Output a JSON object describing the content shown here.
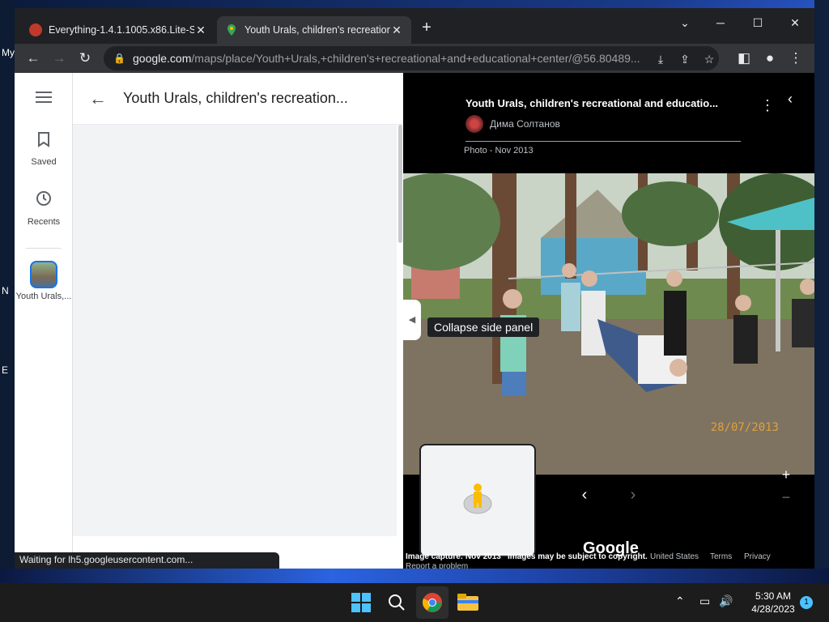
{
  "desktop": {
    "icon_labels": [
      "My",
      "N",
      "E"
    ]
  },
  "browser": {
    "tabs": [
      {
        "title": "Everything-1.4.1.1005.x86.Lite-Se",
        "active": false,
        "favicon": "everything-favicon-icon"
      },
      {
        "title": "Youth Urals, children's recreation",
        "active": true,
        "favicon": "maps-pin-icon"
      }
    ],
    "address": {
      "host": "google.com",
      "path": "/maps/place/Youth+Urals,+children's+recreational+and+educational+center/@56.80489..."
    }
  },
  "maps": {
    "rail": {
      "saved_label": "Saved",
      "recents_label": "Recents",
      "recent_place_label": "Youth Urals,..."
    },
    "side_panel": {
      "title": "Youth Urals, children's recreation..."
    },
    "viewer": {
      "title": "Youth Urals, children's recreational and educatio...",
      "author": "Дима Солтанов",
      "photo_date": "Photo - Nov 2013",
      "date_stamp": "28/07/2013",
      "tooltip": "Collapse side panel",
      "google_logo": "Google",
      "footer": {
        "capture": "Image capture: Nov 2013",
        "copyright": "Images may be subject to copyright.",
        "region": "United States",
        "terms": "Terms",
        "privacy": "Privacy",
        "report": "Report a problem"
      }
    }
  },
  "status_text": "Waiting for lh5.googleusercontent.com...",
  "taskbar": {
    "time": "5:30 AM",
    "date": "4/28/2023",
    "notification_count": "1"
  },
  "colors": {
    "accent": "#1a73e8",
    "pegman": "#fbbc04"
  }
}
